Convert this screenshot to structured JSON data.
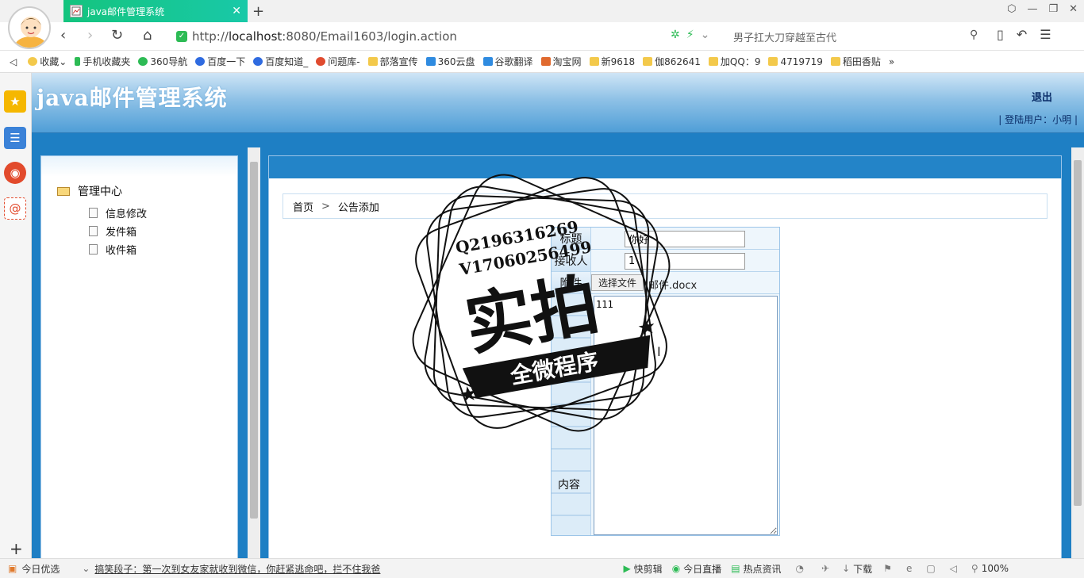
{
  "browser": {
    "tab_title": "java邮件管理系统",
    "url_prefix": "http://",
    "url_host": "localhost",
    "url_rest": ":8080/Email1603/login.action",
    "search_placeholder": "男子扛大刀穿越至古代"
  },
  "bookmarks": [
    {
      "label": "收藏",
      "color": "#f3c94b"
    },
    {
      "label": "手机收藏夹",
      "color": "#2dbb55"
    },
    {
      "label": "360导航",
      "color": "#2dbb55"
    },
    {
      "label": "百度一下",
      "color": "#2f6be0"
    },
    {
      "label": "百度知道_",
      "color": "#2f6be0"
    },
    {
      "label": "问题库-",
      "color": "#e04b2f"
    },
    {
      "label": "部落宣传",
      "color": "#f3c94b"
    },
    {
      "label": "360云盘",
      "color": "#2f8be0"
    },
    {
      "label": "谷歌翻译",
      "color": "#2f8be0"
    },
    {
      "label": "淘宝网",
      "color": "#e06a2f"
    },
    {
      "label": "新9618",
      "color": "#f3c94b"
    },
    {
      "label": "伽862641",
      "color": "#f3c94b"
    },
    {
      "label": "加QQ：9",
      "color": "#f3c94b"
    },
    {
      "label": "4719719",
      "color": "#f3c94b"
    },
    {
      "label": "稻田香贴",
      "color": "#f3c94b"
    }
  ],
  "header": {
    "title": "java邮件管理系统",
    "logout": "退出",
    "login_user": "| 登陆用户：小明 |"
  },
  "sidebar": {
    "root": "管理中心",
    "items": [
      {
        "label": "信息修改"
      },
      {
        "label": "发件箱"
      },
      {
        "label": "收件箱"
      }
    ]
  },
  "breadcrumb": {
    "home": "首页",
    "sep": ">",
    "current": "公告添加"
  },
  "form": {
    "subject_label": "标题",
    "subject_value": "你好",
    "receiver_label": "接收人",
    "receiver_value": "1",
    "attachment_label": "附件",
    "file_button": "选择文件",
    "file_name": "邮件.docx",
    "content_label": "内容",
    "content_value": "111"
  },
  "watermark": {
    "line1": "Q2196316269",
    "line2": "V17060256499",
    "main": "实拍",
    "ribbon": "全微程序"
  },
  "statusbar": {
    "left": "今日优选",
    "news": "搞笑段子：第一次到女友家就收到微信，你赶紧逃命吧，拦不住我爸",
    "quick_edit": "快剪辑",
    "live": "今日直播",
    "hot": "热点资讯",
    "download": "下载",
    "zoom": "100%"
  }
}
